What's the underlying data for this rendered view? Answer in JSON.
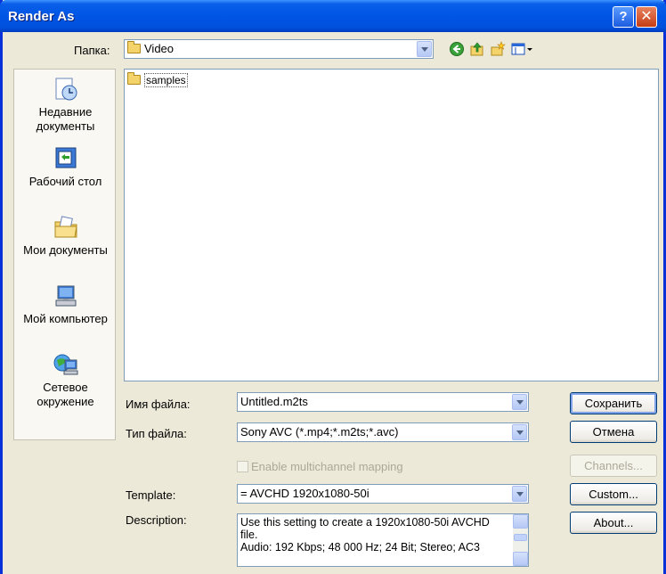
{
  "window": {
    "title": "Render As"
  },
  "toolbar": {
    "folder_label": "Папка:",
    "folder_value": "Video",
    "icons": [
      "back-icon",
      "up-folder-icon",
      "new-folder-icon",
      "view-menu-icon"
    ]
  },
  "places": [
    {
      "label": "Недавние документы",
      "icon": "recent-documents-icon"
    },
    {
      "label": "Рабочий стол",
      "icon": "desktop-icon"
    },
    {
      "label": "Мои документы",
      "icon": "my-documents-icon"
    },
    {
      "label": "Мой компьютер",
      "icon": "my-computer-icon"
    },
    {
      "label": "Сетевое окружение",
      "icon": "network-icon"
    }
  ],
  "files": [
    {
      "name": "samples",
      "type": "folder"
    }
  ],
  "filename": {
    "label": "Имя файла:",
    "value": "Untitled.m2ts"
  },
  "filetype": {
    "label": "Тип файла:",
    "value": "Sony AVC (*.mp4;*.m2ts;*.avc)"
  },
  "multichannel": {
    "label": "Enable multichannel mapping",
    "checked": false
  },
  "template": {
    "label": "Template:",
    "value": "= AVCHD 1920x1080-50i"
  },
  "description": {
    "label": "Description:",
    "text": "Use this setting to create a 1920x1080-50i AVCHD file.\nAudio: 192 Kbps; 48 000 Hz; 24 Bit; Stereo; AC3"
  },
  "buttons": {
    "save": "Сохранить",
    "cancel": "Отмена",
    "channels": "Channels...",
    "custom": "Custom...",
    "about": "About..."
  },
  "colors": {
    "titlebar": "#0055E5",
    "dialog_bg": "#ECE9D8",
    "close_button": "#C63C14"
  }
}
